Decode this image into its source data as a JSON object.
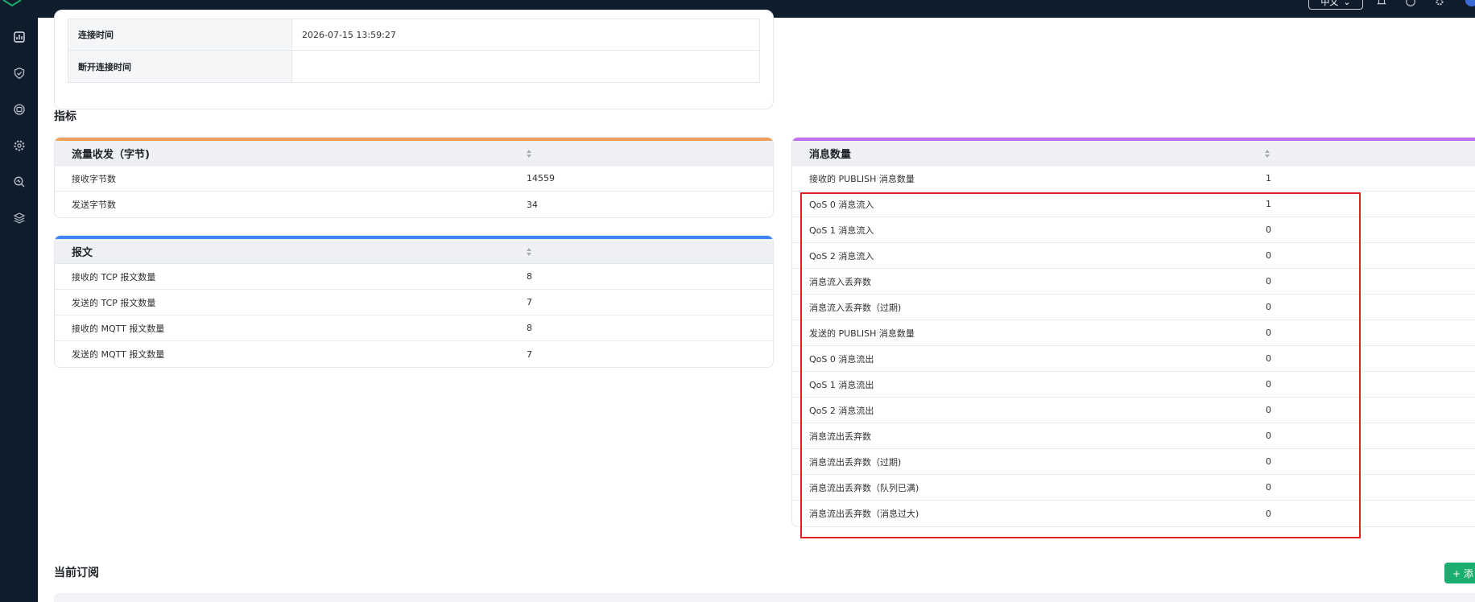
{
  "topbar": {
    "language_button": "中文",
    "icons": [
      "bell-icon",
      "help-icon",
      "settings-icon"
    ]
  },
  "sidebar": {
    "items": [
      {
        "icon": "dashboard-icon"
      },
      {
        "icon": "shield-check-icon"
      },
      {
        "icon": "data-integration-icon"
      },
      {
        "icon": "gear-management-icon"
      },
      {
        "icon": "diagnose-search-icon"
      },
      {
        "icon": "stack-layers-icon"
      }
    ]
  },
  "connection_info": {
    "rows": [
      {
        "key": "连接时间",
        "value": "2026-07-15 13:59:27"
      },
      {
        "key": "断开连接时间",
        "value": ""
      }
    ]
  },
  "metrics_section": {
    "title": "指标"
  },
  "traffic_card": {
    "title": "流量收发（字节)",
    "accent_color": "#f0a05a",
    "rows": [
      {
        "label": "接收字节数",
        "value": "14559"
      },
      {
        "label": "发送字节数",
        "value": "34"
      }
    ]
  },
  "packets_card": {
    "title": "报文",
    "accent_color": "#3d86f5",
    "rows": [
      {
        "label": "接收的 TCP 报文数量",
        "value": "8"
      },
      {
        "label": "发送的 TCP 报文数量",
        "value": "7"
      },
      {
        "label": "接收的 MQTT 报文数量",
        "value": "8"
      },
      {
        "label": "发送的 MQTT 报文数量",
        "value": "7"
      }
    ]
  },
  "messages_card": {
    "title": "消息数量",
    "accent_color": "#c06ef0",
    "rows": [
      {
        "label": "接收的 PUBLISH 消息数量",
        "value": "1"
      },
      {
        "label": "QoS 0 消息流入",
        "value": "1"
      },
      {
        "label": "QoS 1 消息流入",
        "value": "0"
      },
      {
        "label": "QoS 2 消息流入",
        "value": "0"
      },
      {
        "label": "消息流入丢弃数",
        "value": "0"
      },
      {
        "label": "消息流入丢弃数（过期)",
        "value": "0"
      },
      {
        "label": "发送的 PUBLISH 消息数量",
        "value": "0"
      },
      {
        "label": "QoS 0 消息流出",
        "value": "0"
      },
      {
        "label": "QoS 1 消息流出",
        "value": "0"
      },
      {
        "label": "QoS 2 消息流出",
        "value": "0"
      },
      {
        "label": "消息流出丢弃数",
        "value": "0"
      },
      {
        "label": "消息流出丢弃数（过期)",
        "value": "0"
      },
      {
        "label": "消息流出丢弃数（队列已满)",
        "value": "0"
      },
      {
        "label": "消息流出丢弃数（消息过大)",
        "value": "0"
      }
    ]
  },
  "subscriptions_section": {
    "title": "当前订阅",
    "add_button": "+ 添"
  },
  "colors": {
    "sidebar_bg": "#0e1c2b",
    "highlight": "#e02020",
    "primary_green": "#1aae6f"
  }
}
